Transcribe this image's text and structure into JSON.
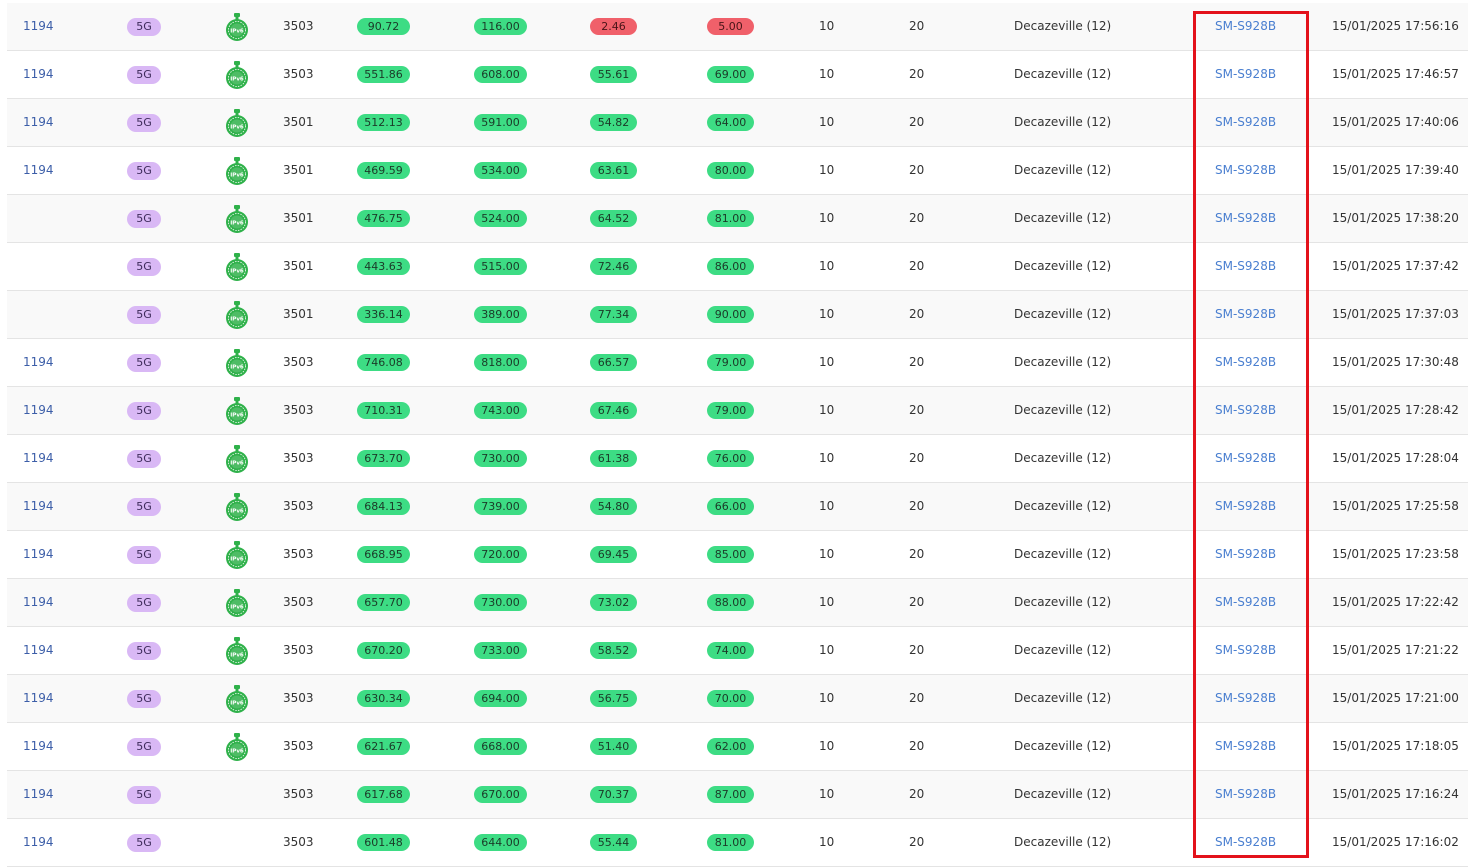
{
  "colors": {
    "link": "#3c5ea8",
    "device_link": "#4a7fd0",
    "good_pill": "#3ddc84",
    "bad_pill": "#f0606a",
    "tech_badge": "#d9b8f5",
    "ipv6_badge": "#2fb14a",
    "highlight_box": "#e3121b"
  },
  "rows": [
    {
      "id": "1194",
      "tech": "5G",
      "ipv6": true,
      "ipv6_icon": "ipv6-badge-icon",
      "cell": "3503",
      "p1": "90.72",
      "p2": "116.00",
      "p3": "2.46",
      "p3_bad": true,
      "p4": "5.00",
      "p4_bad": true,
      "n1": "10",
      "n2": "20",
      "city": "Decazeville (12)",
      "device": "SM-S928B",
      "date": "15/01/2025 17:56:16"
    },
    {
      "id": "1194",
      "tech": "5G",
      "ipv6": true,
      "ipv6_icon": "ipv6-badge-icon",
      "cell": "3503",
      "p1": "551.86",
      "p2": "608.00",
      "p3": "55.61",
      "p4": "69.00",
      "n1": "10",
      "n2": "20",
      "city": "Decazeville (12)",
      "device": "SM-S928B",
      "date": "15/01/2025 17:46:57"
    },
    {
      "id": "1194",
      "tech": "5G",
      "ipv6": true,
      "ipv6_icon": "ipv6-badge-icon",
      "cell": "3501",
      "p1": "512.13",
      "p2": "591.00",
      "p3": "54.82",
      "p4": "64.00",
      "n1": "10",
      "n2": "20",
      "city": "Decazeville (12)",
      "device": "SM-S928B",
      "date": "15/01/2025 17:40:06"
    },
    {
      "id": "1194",
      "tech": "5G",
      "ipv6": true,
      "ipv6_icon": "ipv6-badge-icon",
      "cell": "3501",
      "p1": "469.59",
      "p2": "534.00",
      "p3": "63.61",
      "p4": "80.00",
      "n1": "10",
      "n2": "20",
      "city": "Decazeville (12)",
      "device": "SM-S928B",
      "date": "15/01/2025 17:39:40"
    },
    {
      "id": "",
      "tech": "5G",
      "ipv6": true,
      "ipv6_icon": "ipv6-badge-icon",
      "cell": "3501",
      "p1": "476.75",
      "p2": "524.00",
      "p3": "64.52",
      "p4": "81.00",
      "n1": "10",
      "n2": "20",
      "city": "Decazeville (12)",
      "device": "SM-S928B",
      "date": "15/01/2025 17:38:20"
    },
    {
      "id": "",
      "tech": "5G",
      "ipv6": true,
      "ipv6_icon": "ipv6-badge-icon",
      "cell": "3501",
      "p1": "443.63",
      "p2": "515.00",
      "p3": "72.46",
      "p4": "86.00",
      "n1": "10",
      "n2": "20",
      "city": "Decazeville (12)",
      "device": "SM-S928B",
      "date": "15/01/2025 17:37:42"
    },
    {
      "id": "",
      "tech": "5G",
      "ipv6": true,
      "ipv6_icon": "ipv6-badge-icon",
      "cell": "3501",
      "p1": "336.14",
      "p2": "389.00",
      "p3": "77.34",
      "p4": "90.00",
      "n1": "10",
      "n2": "20",
      "city": "Decazeville (12)",
      "device": "SM-S928B",
      "date": "15/01/2025 17:37:03"
    },
    {
      "id": "1194",
      "tech": "5G",
      "ipv6": true,
      "ipv6_icon": "ipv6-badge-icon",
      "cell": "3503",
      "p1": "746.08",
      "p2": "818.00",
      "p3": "66.57",
      "p4": "79.00",
      "n1": "10",
      "n2": "20",
      "city": "Decazeville (12)",
      "device": "SM-S928B",
      "date": "15/01/2025 17:30:48"
    },
    {
      "id": "1194",
      "tech": "5G",
      "ipv6": true,
      "ipv6_icon": "ipv6-badge-icon",
      "cell": "3503",
      "p1": "710.31",
      "p2": "743.00",
      "p3": "67.46",
      "p4": "79.00",
      "n1": "10",
      "n2": "20",
      "city": "Decazeville (12)",
      "device": "SM-S928B",
      "date": "15/01/2025 17:28:42"
    },
    {
      "id": "1194",
      "tech": "5G",
      "ipv6": true,
      "ipv6_icon": "ipv6-badge-icon",
      "cell": "3503",
      "p1": "673.70",
      "p2": "730.00",
      "p3": "61.38",
      "p4": "76.00",
      "n1": "10",
      "n2": "20",
      "city": "Decazeville (12)",
      "device": "SM-S928B",
      "date": "15/01/2025 17:28:04"
    },
    {
      "id": "1194",
      "tech": "5G",
      "ipv6": true,
      "ipv6_icon": "ipv6-badge-icon",
      "cell": "3503",
      "p1": "684.13",
      "p2": "739.00",
      "p3": "54.80",
      "p4": "66.00",
      "n1": "10",
      "n2": "20",
      "city": "Decazeville (12)",
      "device": "SM-S928B",
      "date": "15/01/2025 17:25:58"
    },
    {
      "id": "1194",
      "tech": "5G",
      "ipv6": true,
      "ipv6_icon": "ipv6-badge-icon",
      "cell": "3503",
      "p1": "668.95",
      "p2": "720.00",
      "p3": "69.45",
      "p4": "85.00",
      "n1": "10",
      "n2": "20",
      "city": "Decazeville (12)",
      "device": "SM-S928B",
      "date": "15/01/2025 17:23:58"
    },
    {
      "id": "1194",
      "tech": "5G",
      "ipv6": true,
      "ipv6_icon": "ipv6-badge-icon",
      "cell": "3503",
      "p1": "657.70",
      "p2": "730.00",
      "p3": "73.02",
      "p4": "88.00",
      "n1": "10",
      "n2": "20",
      "city": "Decazeville (12)",
      "device": "SM-S928B",
      "date": "15/01/2025 17:22:42"
    },
    {
      "id": "1194",
      "tech": "5G",
      "ipv6": true,
      "ipv6_icon": "ipv6-badge-icon",
      "cell": "3503",
      "p1": "670.20",
      "p2": "733.00",
      "p3": "58.52",
      "p4": "74.00",
      "n1": "10",
      "n2": "20",
      "city": "Decazeville (12)",
      "device": "SM-S928B",
      "date": "15/01/2025 17:21:22"
    },
    {
      "id": "1194",
      "tech": "5G",
      "ipv6": true,
      "ipv6_icon": "ipv6-badge-icon",
      "cell": "3503",
      "p1": "630.34",
      "p2": "694.00",
      "p3": "56.75",
      "p4": "70.00",
      "n1": "10",
      "n2": "20",
      "city": "Decazeville (12)",
      "device": "SM-S928B",
      "date": "15/01/2025 17:21:00"
    },
    {
      "id": "1194",
      "tech": "5G",
      "ipv6": true,
      "ipv6_icon": "ipv6-badge-icon",
      "cell": "3503",
      "p1": "621.67",
      "p2": "668.00",
      "p3": "51.40",
      "p4": "62.00",
      "n1": "10",
      "n2": "20",
      "city": "Decazeville (12)",
      "device": "SM-S928B",
      "date": "15/01/2025 17:18:05"
    },
    {
      "id": "1194",
      "tech": "5G",
      "ipv6": false,
      "cell": "3503",
      "p1": "617.68",
      "p2": "670.00",
      "p3": "70.37",
      "p4": "87.00",
      "n1": "10",
      "n2": "20",
      "city": "Decazeville (12)",
      "device": "SM-S928B",
      "date": "15/01/2025 17:16:24"
    },
    {
      "id": "1194",
      "tech": "5G",
      "ipv6": false,
      "cell": "3503",
      "p1": "601.48",
      "p2": "644.00",
      "p3": "55.44",
      "p4": "81.00",
      "n1": "10",
      "n2": "20",
      "city": "Decazeville (12)",
      "device": "SM-S928B",
      "date": "15/01/2025 17:16:02"
    }
  ]
}
